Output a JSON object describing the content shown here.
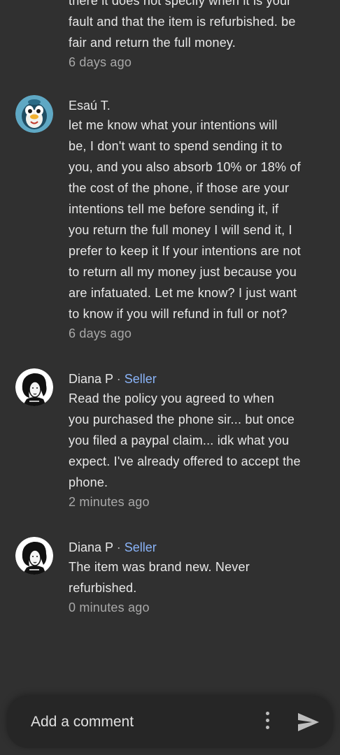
{
  "thread": {
    "partial_comment": {
      "lines": [
        "there it does not specify when it is your",
        "fault and that the item is refurbished.  be",
        "fair and return the full money."
      ],
      "time": "6 days ago"
    },
    "comments": [
      {
        "author": "Esaú T.",
        "role": "",
        "avatar_icon": "penguin-avatar-icon",
        "lines": [
          "let me know what your intentions will",
          "be, I don't want to spend sending it to",
          "you, and you also absorb 10% or 18% of",
          "the cost of the phone, if those are your",
          "intentions tell me before sending it, if",
          "you return the full money I will send it, I",
          "prefer to keep it If your intentions are not",
          "to return all my money just because you",
          "are infatuated. Let me know? I just want",
          "to know if you will refund in full or not?"
        ],
        "time": "6 days ago"
      },
      {
        "author": "Diana P",
        "separator": "·",
        "role": "Seller",
        "avatar_icon": "portrait-avatar-icon",
        "lines": [
          "Read the policy you agreed to when",
          "you purchased the phone sir... but once",
          "you filed a paypal claim... idk what you",
          "expect. I've already offered to accept the",
          "phone."
        ],
        "time": "2 minutes ago"
      },
      {
        "author": "Diana P",
        "separator": "·",
        "role": "Seller",
        "avatar_icon": "portrait-avatar-icon",
        "lines": [
          "The item was brand new. Never",
          "refurbished."
        ],
        "time": "0 minutes ago"
      }
    ]
  },
  "composer": {
    "placeholder": "Add a comment",
    "more_icon": "more-vertical-icon",
    "send_icon": "send-icon"
  },
  "colors": {
    "background": "#303030",
    "seller_badge": "#8ab4f8",
    "timestamp": "#a8a8a8",
    "composer_bg": "#262626"
  }
}
